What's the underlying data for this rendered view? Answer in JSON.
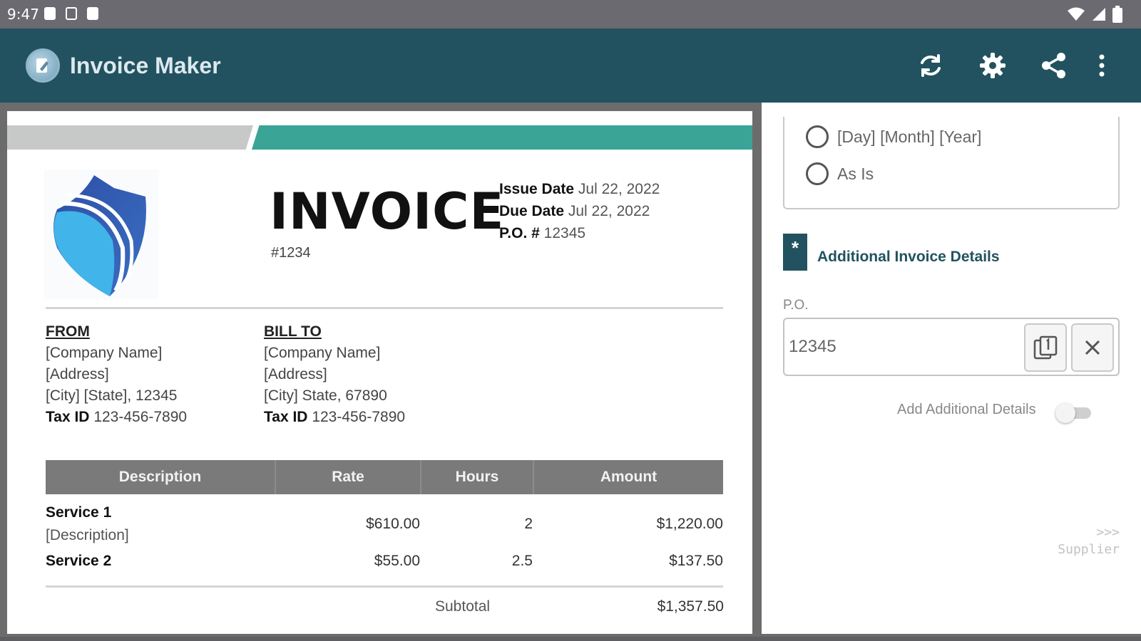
{
  "status_bar": {
    "time": "9:47"
  },
  "app": {
    "title": "Invoice Maker"
  },
  "toolbar": {
    "icons": [
      "sync-icon",
      "settings-icon",
      "share-icon",
      "more-vert-icon"
    ]
  },
  "invoice": {
    "title": "INVOICE",
    "number": "#1234",
    "issue_date_label": "Issue Date",
    "issue_date": "Jul 22, 2022",
    "due_date_label": "Due Date",
    "due_date": "Jul 22, 2022",
    "po_label": "P.O. #",
    "po_value": "12345",
    "from": {
      "heading": "FROM",
      "company": "[Company Name]",
      "address": "[Address]",
      "city_line": "[City] [State], 12345",
      "tax_label": "Tax ID",
      "tax_id": "123-456-7890"
    },
    "bill_to": {
      "heading": "BILL TO",
      "company": "[Company Name]",
      "address": "[Address]",
      "city_line": "[City] State, 67890",
      "tax_label": "Tax ID",
      "tax_id": "123-456-7890"
    },
    "table": {
      "headers": [
        "Description",
        "Rate",
        "Hours",
        "Amount"
      ],
      "rows": [
        {
          "service": "Service 1",
          "description": "[Description]",
          "rate": "$610.00",
          "hours": "2",
          "amount": "$1,220.00"
        },
        {
          "service": "Service 2",
          "description": "",
          "rate": "$55.00",
          "hours": "2.5",
          "amount": "$137.50"
        }
      ],
      "subtotal_label": "Subtotal",
      "subtotal": "$1,357.50"
    },
    "colors": {
      "teal_band": "#3aa497",
      "gray_band": "#c7c8c8",
      "header_gray": "#7a7a7a"
    }
  },
  "side_panel": {
    "date_format_options": [
      "[Day] [Month] [Year]",
      "As Is"
    ],
    "section_badge": "*",
    "section_title": "Additional Invoice Details",
    "po_field": {
      "label": "P.O.",
      "value": "12345"
    },
    "add_details_label": "Add Additional Details",
    "add_details_enabled": false,
    "supplier_link_arrow": ">>>",
    "supplier_link_label": "Supplier"
  },
  "colors": {
    "app_bar": "#22525f",
    "status_bar": "#6b6a70"
  }
}
